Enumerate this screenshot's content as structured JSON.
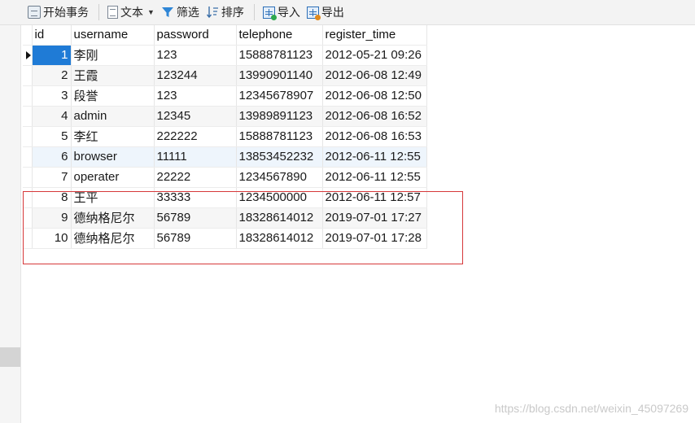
{
  "toolbar": {
    "begin_tx": "开始事务",
    "text": "文本",
    "filter": "筛选",
    "sort": "排序",
    "import": "导入",
    "export": "导出"
  },
  "grid": {
    "columns": [
      "id",
      "username",
      "password",
      "telephone",
      "register_time"
    ],
    "rows": [
      {
        "id": "1",
        "username": "李刚",
        "password": "123",
        "telephone": "15888781123",
        "register_time": "2012-05-21 09:26"
      },
      {
        "id": "2",
        "username": "王霞",
        "password": "123244",
        "telephone": "13990901140",
        "register_time": "2012-06-08 12:49"
      },
      {
        "id": "3",
        "username": "段誉",
        "password": "123",
        "telephone": "12345678907",
        "register_time": "2012-06-08 12:50"
      },
      {
        "id": "4",
        "username": "admin",
        "password": "12345",
        "telephone": "13989891123",
        "register_time": "2012-06-08 16:52"
      },
      {
        "id": "5",
        "username": "李红",
        "password": "222222",
        "telephone": "15888781123",
        "register_time": "2012-06-08 16:53"
      },
      {
        "id": "6",
        "username": "browser",
        "password": "11111",
        "telephone": "13853452232",
        "register_time": "2012-06-11 12:55"
      },
      {
        "id": "7",
        "username": "operater",
        "password": "22222",
        "telephone": "1234567890",
        "register_time": "2012-06-11 12:55"
      },
      {
        "id": "8",
        "username": "王平",
        "password": "33333",
        "telephone": "1234500000",
        "register_time": "2012-06-11 12:57"
      },
      {
        "id": "9",
        "username": "德纳格尼尔",
        "password": "56789",
        "telephone": "18328614012",
        "register_time": "2019-07-01 17:27"
      },
      {
        "id": "10",
        "username": "德纳格尼尔",
        "password": "56789",
        "telephone": "18328614012",
        "register_time": "2019-07-01 17:28"
      }
    ]
  },
  "watermark": "https://blog.csdn.net/weixin_45097269",
  "colors": {
    "selection": "#1f7bd6",
    "annotation_box": "#d6383a"
  }
}
